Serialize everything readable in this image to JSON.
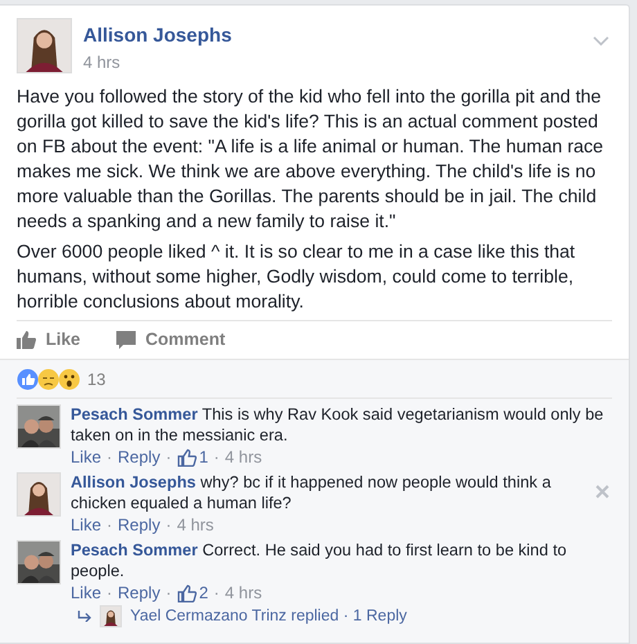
{
  "post": {
    "author": "Allison Josephs",
    "time": "4 hrs",
    "paragraphs": [
      "Have you followed the story of the kid who fell into the gorilla pit and the gorilla got killed to save the kid's life? This is an actual comment posted on FB about the event: \"A life is a life animal or human. The human race makes me sick. We think we are above everything. The child's life is no more valuable than the Gorillas. The parents should be in jail. The child needs a spanking and a new family to raise it.\"",
      "Over 6000 people liked ^ it. It is so clear to me in a case like this that humans, without some higher, Godly wisdom, could come to terrible, horrible conclusions about morality."
    ],
    "actions": [
      {
        "kind": "like",
        "label": "Like"
      },
      {
        "kind": "comment",
        "label": "Comment"
      }
    ]
  },
  "reactions": {
    "count": "13"
  },
  "separator": "·",
  "comments": [
    {
      "author": "Pesach Sommer",
      "text": "This is why Rav Kook said vegetarianism would only be taken on in the messianic era.",
      "like": "Like",
      "reply": "Reply",
      "likes": "1",
      "time": "4 hrs",
      "close": false
    },
    {
      "author": "Allison Josephs",
      "text": "why? bc if it happened now people would think a chicken equaled a human life?",
      "like": "Like",
      "reply": "Reply",
      "time": "4 hrs",
      "close": true
    },
    {
      "author": "Pesach Sommer",
      "text": "Correct. He said you had to first learn to be kind to people.",
      "like": "Like",
      "reply": "Reply",
      "likes": "2",
      "time": "4 hrs",
      "close": false
    }
  ],
  "replies": {
    "name": "Yael Cermazano Trinz",
    "verb": "replied",
    "count": "1 Reply"
  }
}
